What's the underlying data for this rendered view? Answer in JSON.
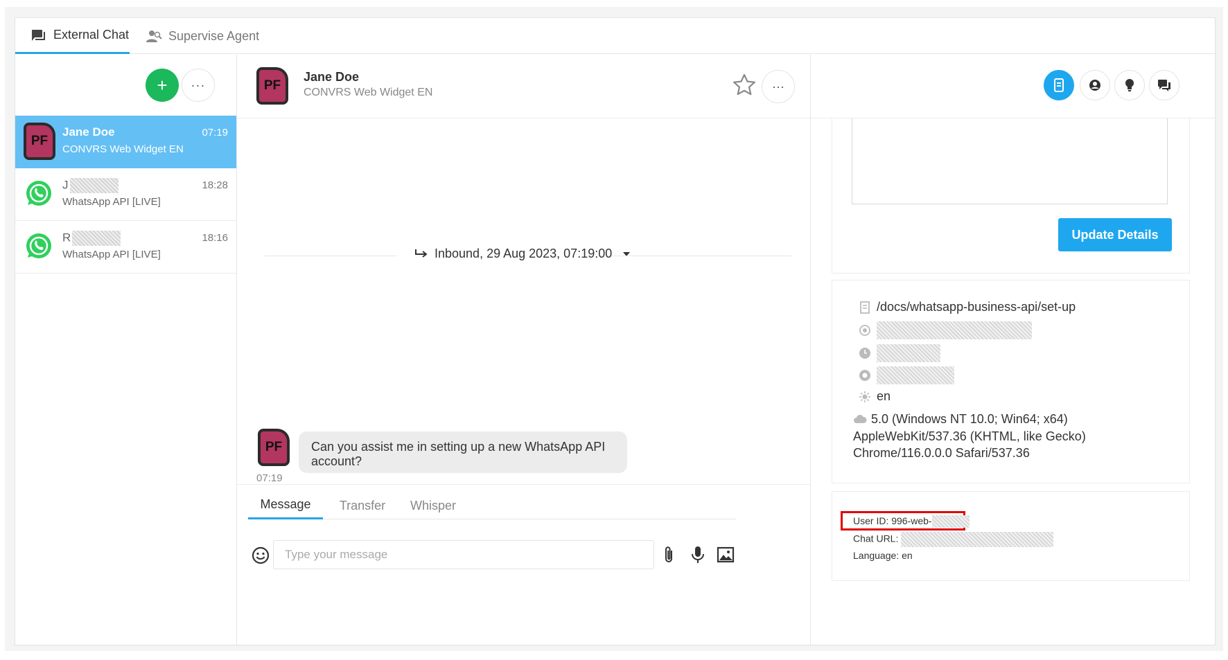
{
  "tabs": [
    {
      "label": "External Chat",
      "icon": "chat-icon",
      "active": true
    },
    {
      "label": "Supervise Agent",
      "icon": "supervise-agent-icon",
      "active": false
    }
  ],
  "chat_list": {
    "add_label": "+",
    "more_label": "···",
    "items": [
      {
        "avatar": "PF",
        "name": "Jane Doe",
        "channel": "CONVRS Web Widget EN",
        "time": "07:19",
        "selected": true
      },
      {
        "avatar": "whatsapp-icon",
        "name": "J",
        "channel": "WhatsApp API [LIVE]",
        "time": "18:28",
        "selected": false
      },
      {
        "avatar": "whatsapp-icon",
        "name": "R",
        "channel": "WhatsApp API [LIVE]",
        "time": "18:16",
        "selected": false
      }
    ]
  },
  "conversation": {
    "avatar": "PF",
    "name": "Jane Doe",
    "channel": "CONVRS Web Widget EN",
    "more_label": "···",
    "divider_label": "Inbound, 29 Aug 2023, 07:19:00",
    "message": {
      "avatar": "PF",
      "text": "Can you assist me in setting up a new WhatsApp API account?",
      "time": "07:19"
    }
  },
  "composer": {
    "tabs": [
      "Message",
      "Transfer",
      "Whisper"
    ],
    "active_tab": "Message",
    "placeholder": "Type your message"
  },
  "details": {
    "update_button": "Update Details",
    "page_path": "/docs/whatsapp-business-api/set-up",
    "language": "en",
    "user_agent": "5.0 (Windows NT 10.0; Win64; x64) AppleWebKit/537.36 (KHTML, like Gecko) Chrome/116.0.0.0 Safari/537.36",
    "user_id_label": "User ID: 996-web-",
    "chat_url_label": "Chat URL:",
    "language_label": "Language: en"
  },
  "colors": {
    "accent": "#1ea7ef",
    "selected_row": "#64bff5",
    "add_button": "#1cb85c",
    "avatar": "#b2365f",
    "highlight": "#e00000"
  }
}
